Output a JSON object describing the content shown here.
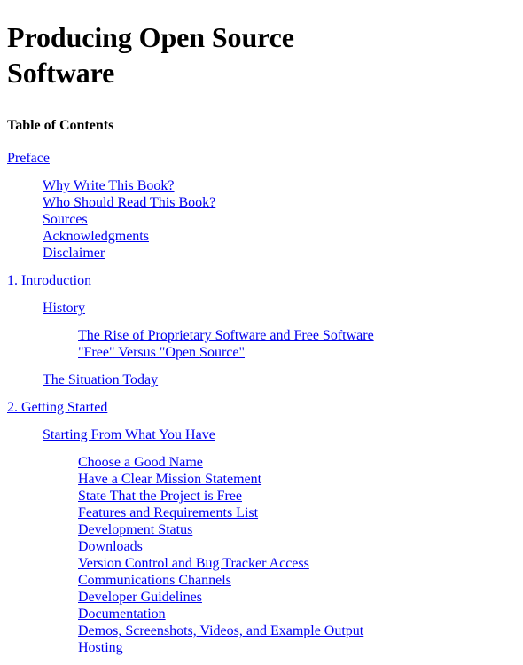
{
  "book": {
    "title": "Producing Open Source Software",
    "toc_heading": "Table of Contents"
  },
  "colors": {
    "link": "#0000EE",
    "text": "#000000",
    "background": "#FFFFFF"
  },
  "toc": {
    "blocks": [
      {
        "level": 1,
        "label": "Preface",
        "children": [
          {
            "level": 2,
            "label": "Why Write This Book?"
          },
          {
            "level": 2,
            "label": "Who Should Read This Book?"
          },
          {
            "level": 2,
            "label": "Sources"
          },
          {
            "level": 2,
            "label": "Acknowledgments"
          },
          {
            "level": 2,
            "label": "Disclaimer"
          }
        ]
      },
      {
        "level": 1,
        "label": "1. Introduction",
        "children": [
          {
            "level": 2,
            "label": "History",
            "children": [
              {
                "level": 3,
                "label": "The Rise of Proprietary Software and Free Software"
              },
              {
                "level": 3,
                "label": "\"Free\" Versus \"Open Source\""
              }
            ]
          },
          {
            "level": 2,
            "label": "The Situation Today"
          }
        ]
      },
      {
        "level": 1,
        "label": "2. Getting Started",
        "children": [
          {
            "level": 2,
            "label": "Starting From What You Have",
            "children": [
              {
                "level": 3,
                "label": "Choose a Good Name"
              },
              {
                "level": 3,
                "label": "Have a Clear Mission Statement"
              },
              {
                "level": 3,
                "label": "State That the Project is Free"
              },
              {
                "level": 3,
                "label": "Features and Requirements List"
              },
              {
                "level": 3,
                "label": "Development Status"
              },
              {
                "level": 3,
                "label": "Downloads"
              },
              {
                "level": 3,
                "label": "Version Control and Bug Tracker Access"
              },
              {
                "level": 3,
                "label": "Communications Channels"
              },
              {
                "level": 3,
                "label": "Developer Guidelines"
              },
              {
                "level": 3,
                "label": "Documentation"
              },
              {
                "level": 3,
                "label": "Demos, Screenshots, Videos, and Example Output"
              },
              {
                "level": 3,
                "label": "Hosting"
              }
            ]
          }
        ]
      }
    ]
  }
}
